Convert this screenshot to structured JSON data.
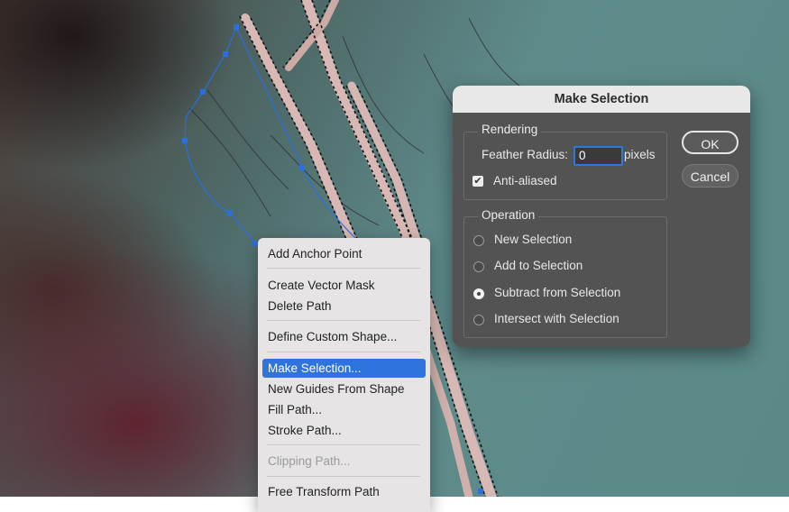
{
  "context_menu": {
    "items": [
      {
        "label": "Add Anchor Point",
        "state": "normal"
      },
      {
        "label": "Create Vector Mask",
        "state": "normal"
      },
      {
        "label": "Delete Path",
        "state": "normal"
      },
      {
        "label": "Define Custom Shape...",
        "state": "normal"
      },
      {
        "label": "Make Selection...",
        "state": "selected"
      },
      {
        "label": "New Guides From Shape",
        "state": "normal"
      },
      {
        "label": "Fill Path...",
        "state": "normal"
      },
      {
        "label": "Stroke Path...",
        "state": "normal"
      },
      {
        "label": "Clipping Path...",
        "state": "disabled"
      },
      {
        "label": "Free Transform Path",
        "state": "normal"
      }
    ]
  },
  "dialog": {
    "title": "Make Selection",
    "rendering": {
      "legend": "Rendering",
      "feather_label": "Feather Radius:",
      "feather_value": "0",
      "feather_unit": "pixels",
      "anti_aliased_label": "Anti-aliased",
      "anti_aliased_checked": true
    },
    "operation": {
      "legend": "Operation",
      "options": [
        {
          "label": "New Selection",
          "selected": false
        },
        {
          "label": "Add to Selection",
          "selected": false
        },
        {
          "label": "Subtract from Selection",
          "selected": true
        },
        {
          "label": "Intersect with Selection",
          "selected": false
        }
      ]
    },
    "ok_label": "OK",
    "cancel_label": "Cancel"
  },
  "colors": {
    "selection_highlight": "#2f74dd",
    "path_anchor": "#2a6fe0",
    "focus_ring": "#2e78d8"
  }
}
